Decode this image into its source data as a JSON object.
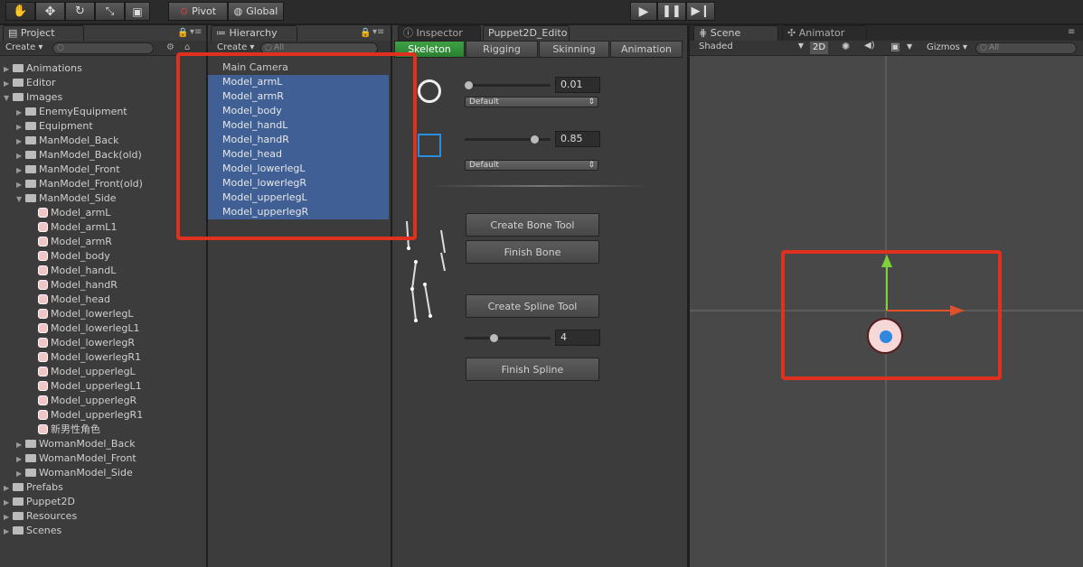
{
  "toolbar": {
    "pivot_label": "Pivot",
    "global_label": "Global"
  },
  "project": {
    "tab_label": "Project",
    "create_label": "Create ▾",
    "items": [
      {
        "label": "Animations",
        "depth": 0,
        "kind": "folder",
        "expanded": false
      },
      {
        "label": "Editor",
        "depth": 0,
        "kind": "folder",
        "expanded": false
      },
      {
        "label": "Images",
        "depth": 0,
        "kind": "folder",
        "expanded": true
      },
      {
        "label": "EnemyEquipment",
        "depth": 1,
        "kind": "folder",
        "expanded": false
      },
      {
        "label": "Equipment",
        "depth": 1,
        "kind": "folder",
        "expanded": false
      },
      {
        "label": "ManModel_Back",
        "depth": 1,
        "kind": "folder",
        "expanded": false
      },
      {
        "label": "ManModel_Back(old)",
        "depth": 1,
        "kind": "folder",
        "expanded": false
      },
      {
        "label": "ManModel_Front",
        "depth": 1,
        "kind": "folder",
        "expanded": false
      },
      {
        "label": "ManModel_Front(old)",
        "depth": 1,
        "kind": "folder",
        "expanded": false
      },
      {
        "label": "ManModel_Side",
        "depth": 1,
        "kind": "folder",
        "expanded": true
      },
      {
        "label": "Model_armL",
        "depth": 2,
        "kind": "sprite",
        "expanded": false
      },
      {
        "label": "Model_armL1",
        "depth": 2,
        "kind": "sprite",
        "expanded": false
      },
      {
        "label": "Model_armR",
        "depth": 2,
        "kind": "sprite",
        "expanded": false
      },
      {
        "label": "Model_body",
        "depth": 2,
        "kind": "sprite",
        "expanded": false
      },
      {
        "label": "Model_handL",
        "depth": 2,
        "kind": "sprite",
        "expanded": false
      },
      {
        "label": "Model_handR",
        "depth": 2,
        "kind": "sprite",
        "expanded": false
      },
      {
        "label": "Model_head",
        "depth": 2,
        "kind": "sprite",
        "expanded": false
      },
      {
        "label": "Model_lowerlegL",
        "depth": 2,
        "kind": "sprite",
        "expanded": false
      },
      {
        "label": "Model_lowerlegL1",
        "depth": 2,
        "kind": "sprite",
        "expanded": false
      },
      {
        "label": "Model_lowerlegR",
        "depth": 2,
        "kind": "sprite",
        "expanded": false
      },
      {
        "label": "Model_lowerlegR1",
        "depth": 2,
        "kind": "sprite",
        "expanded": false
      },
      {
        "label": "Model_upperlegL",
        "depth": 2,
        "kind": "sprite",
        "expanded": false
      },
      {
        "label": "Model_upperlegL1",
        "depth": 2,
        "kind": "sprite",
        "expanded": false
      },
      {
        "label": "Model_upperlegR",
        "depth": 2,
        "kind": "sprite",
        "expanded": false
      },
      {
        "label": "Model_upperlegR1",
        "depth": 2,
        "kind": "sprite",
        "expanded": false
      },
      {
        "label": "新男性角色",
        "depth": 2,
        "kind": "sprite",
        "expanded": false
      },
      {
        "label": "WomanModel_Back",
        "depth": 1,
        "kind": "folder",
        "expanded": false
      },
      {
        "label": "WomanModel_Front",
        "depth": 1,
        "kind": "folder",
        "expanded": false
      },
      {
        "label": "WomanModel_Side",
        "depth": 1,
        "kind": "folder",
        "expanded": false
      },
      {
        "label": "Prefabs",
        "depth": 0,
        "kind": "folder",
        "expanded": false
      },
      {
        "label": "Puppet2D",
        "depth": 0,
        "kind": "folder",
        "expanded": false
      },
      {
        "label": "Resources",
        "depth": 0,
        "kind": "folder",
        "expanded": false
      },
      {
        "label": "Scenes",
        "depth": 0,
        "kind": "folder",
        "expanded": false
      }
    ]
  },
  "hierarchy": {
    "tab_label": "Hierarchy",
    "create_label": "Create ▾",
    "search_placeholder": "All",
    "items": [
      {
        "label": "Main Camera",
        "selected": false
      },
      {
        "label": "Model_armL",
        "selected": true
      },
      {
        "label": "Model_armR",
        "selected": true
      },
      {
        "label": "Model_body",
        "selected": true
      },
      {
        "label": "Model_handL",
        "selected": true
      },
      {
        "label": "Model_handR",
        "selected": true
      },
      {
        "label": "Model_head",
        "selected": true
      },
      {
        "label": "Model_lowerlegL",
        "selected": true
      },
      {
        "label": "Model_lowerlegR",
        "selected": true
      },
      {
        "label": "Model_upperlegL",
        "selected": true
      },
      {
        "label": "Model_upperlegR",
        "selected": true
      }
    ]
  },
  "inspector": {
    "tab_label": "Inspector",
    "puppet_tab_label": "Puppet2D_Edito",
    "subtabs": [
      "Skeleton",
      "Rigging",
      "Skinning",
      "Animation"
    ],
    "bone_size_value": "0.01",
    "bone_dropdown": "Default",
    "control_size_value": "0.85",
    "control_dropdown": "Default",
    "create_bone_tool": "Create Bone Tool",
    "finish_bone": "Finish Bone",
    "create_spline_tool": "Create Spline Tool",
    "spline_count_value": "4",
    "finish_spline": "Finish Spline"
  },
  "scene": {
    "tab_label": "Scene",
    "animator_tab_label": "Animator",
    "shading_mode": "Shaded",
    "mode_2d": "2D",
    "gizmos_label": "Gizmos ▾",
    "search_placeholder": "All"
  },
  "colors": {
    "selection": "#3f5f95",
    "highlight_box": "#e0301e",
    "accent_green": "#3ea245"
  }
}
